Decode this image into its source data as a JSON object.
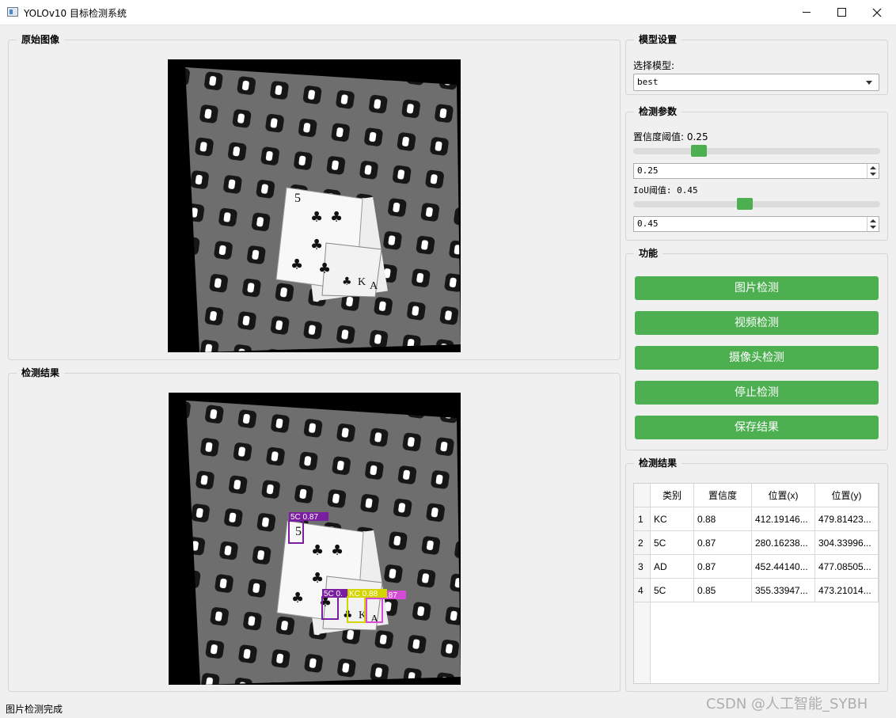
{
  "window": {
    "title": "YOLOv10 目标检测系统"
  },
  "original_panel": {
    "title": "原始图像"
  },
  "result_panel": {
    "title": "检测结果",
    "box_labels": [
      "5C 0.87",
      "5C 0.",
      "KC 0.88",
      ".87"
    ]
  },
  "model_settings": {
    "title": "模型设置",
    "select_label": "选择模型:",
    "selected_model": "best"
  },
  "detect_params": {
    "title": "检测参数",
    "conf_label": "置信度阈值: 0.25",
    "conf_value": "0.25",
    "conf_fraction": 0.25,
    "iou_label": "IoU阈值: 0.45",
    "iou_value": "0.45",
    "iou_fraction": 0.45
  },
  "functions": {
    "title": "功能",
    "image_detect": "图片检测",
    "video_detect": "视频检测",
    "camera_detect": "摄像头检测",
    "stop_detect": "停止检测",
    "save_results": "保存结果"
  },
  "results_table": {
    "title": "检测结果",
    "columns": [
      "类别",
      "置信度",
      "位置(x)",
      "位置(y)"
    ],
    "rows": [
      {
        "index": "1",
        "cls": "KC",
        "conf": "0.88",
        "x": "412.19146...",
        "y": "479.81423..."
      },
      {
        "index": "2",
        "cls": "5C",
        "conf": "0.87",
        "x": "280.16238...",
        "y": "304.33996..."
      },
      {
        "index": "3",
        "cls": "AD",
        "conf": "0.87",
        "x": "452.44140...",
        "y": "477.08505..."
      },
      {
        "index": "4",
        "cls": "5C",
        "conf": "0.85",
        "x": "355.33947...",
        "y": "473.21014..."
      }
    ]
  },
  "status": {
    "text": "图片检测完成"
  },
  "watermark": {
    "text": "CSDN @人工智能_SYBH"
  },
  "colors": {
    "accent": "#4caf50",
    "box_purple": "#7b1fa2",
    "box_yellow": "#d4d400",
    "box_magenta": "#d64bd6"
  }
}
